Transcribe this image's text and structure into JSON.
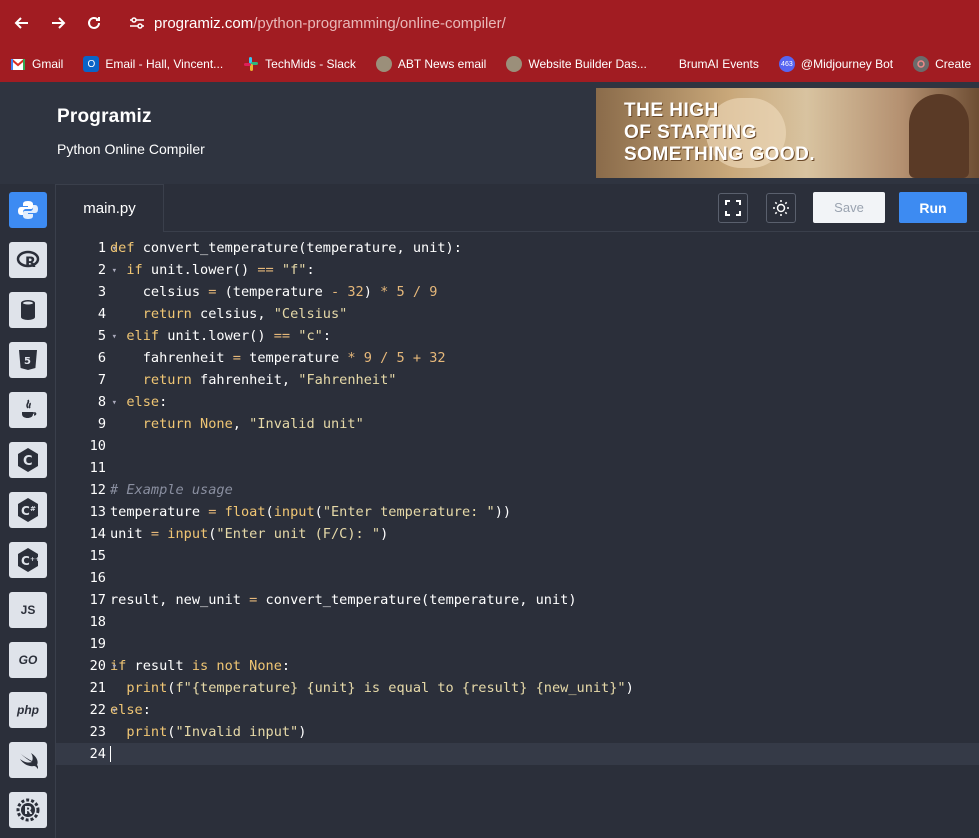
{
  "browser": {
    "url_host": "programiz.com",
    "url_path": "/python-programming/online-compiler/",
    "bookmarks": [
      {
        "label": "Gmail",
        "icon": "gmail-icon"
      },
      {
        "label": "Email - Hall, Vincent...",
        "icon": "outlook-icon"
      },
      {
        "label": "TechMids - Slack",
        "icon": "slack-icon"
      },
      {
        "label": "ABT News email",
        "icon": "globe-icon"
      },
      {
        "label": "Website Builder Das...",
        "icon": "globe-icon"
      },
      {
        "label": "BrumAI Events",
        "icon": "none"
      },
      {
        "label": "@Midjourney Bot",
        "icon": "discord-icon",
        "badge": "463"
      },
      {
        "label": "Create",
        "icon": "create-icon"
      }
    ]
  },
  "header": {
    "logo": "Programiz",
    "subtitle": "Python Online Compiler",
    "ad_text": [
      "THE HIGH",
      "OF STARTING",
      "SOMETHING GOOD."
    ]
  },
  "sidebar": {
    "languages": [
      "python",
      "r",
      "sql",
      "html",
      "java",
      "c",
      "csharp",
      "cpp",
      "js",
      "go",
      "php",
      "swift",
      "rust"
    ],
    "labels": {
      "js": "JS",
      "go": "GO",
      "php": "php"
    }
  },
  "editor": {
    "filename": "main.py",
    "save_label": "Save",
    "run_label": "Run",
    "line_numbers": [
      "1",
      "2",
      "3",
      "4",
      "5",
      "6",
      "7",
      "8",
      "9",
      "10",
      "11",
      "12",
      "13",
      "14",
      "15",
      "16",
      "17",
      "18",
      "19",
      "20",
      "21",
      "22",
      "23",
      "24"
    ],
    "code_lines": [
      "def convert_temperature(temperature, unit):",
      "  if unit.lower() == \"f\":",
      "    celsius = (temperature - 32) * 5 / 9",
      "    return celsius, \"Celsius\"",
      "  elif unit.lower() == \"c\":",
      "    fahrenheit = temperature * 9 / 5 + 32",
      "    return fahrenheit, \"Fahrenheit\"",
      "  else:",
      "    return None, \"Invalid unit\"",
      "",
      "",
      "# Example usage",
      "temperature = float(input(\"Enter temperature: \"))",
      "unit = input(\"Enter unit (F/C): \")",
      "",
      "",
      "result, new_unit = convert_temperature(temperature, unit)",
      "",
      "",
      "if result is not None:",
      "  print(f\"{temperature} {unit} is equal to {result} {new_unit}\")",
      "else:",
      "  print(\"Invalid input\")",
      ""
    ],
    "foldable_lines": [
      "1",
      "2",
      "5",
      "8",
      "20",
      "22"
    ],
    "current_line": "24"
  }
}
